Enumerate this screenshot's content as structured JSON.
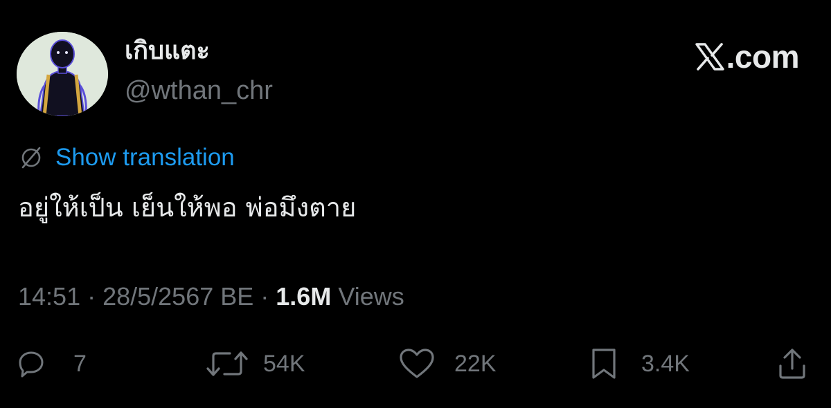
{
  "author": {
    "display_name": "เกิบแตะ",
    "handle": "@wthan_chr"
  },
  "brand": {
    "label": ".com",
    "icon": "x-logo-icon"
  },
  "translation": {
    "label": "Show translation",
    "icon": "globe-icon"
  },
  "tweet": {
    "text": "อยู่ให้เป็น เย็นให้พอ พ่อมึงตาย"
  },
  "meta": {
    "time": "14:51",
    "separator": " · ",
    "date": "28/5/2567 BE",
    "views_count": "1.6M",
    "views_label": " Views"
  },
  "actions": {
    "replies": {
      "icon": "reply-icon",
      "count": "7"
    },
    "retweets": {
      "icon": "retweet-icon",
      "count": "54K"
    },
    "likes": {
      "icon": "heart-icon",
      "count": "22K"
    },
    "bookmarks": {
      "icon": "bookmark-icon",
      "count": "3.4K"
    },
    "share": {
      "icon": "share-icon"
    }
  },
  "colors": {
    "background": "#000000",
    "primary_text": "#e7e9ea",
    "secondary_text": "#71767b",
    "link": "#1d9bf0",
    "avatar_bg": "#dfe8dc"
  }
}
